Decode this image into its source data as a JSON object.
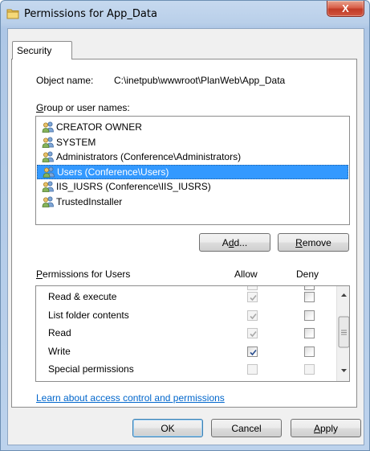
{
  "window": {
    "title": "Permissions for App_Data",
    "close_label": "X"
  },
  "tabs": [
    {
      "label": "Security"
    }
  ],
  "object": {
    "label": "Object name:",
    "value": "C:\\inetpub\\wwwroot\\PlanWeb\\App_Data"
  },
  "groups": {
    "label": "Group or user names:",
    "items": [
      {
        "label": "CREATOR OWNER",
        "selected": false
      },
      {
        "label": "SYSTEM",
        "selected": false
      },
      {
        "label": "Administrators (Conference\\Administrators)",
        "selected": false
      },
      {
        "label": "Users (Conference\\Users)",
        "selected": true
      },
      {
        "label": "IIS_IUSRS (Conference\\IIS_IUSRS)",
        "selected": false
      },
      {
        "label": "TrustedInstaller",
        "selected": false
      }
    ],
    "add_label": "Add...",
    "remove_label": "Remove"
  },
  "permissions": {
    "label": "Permissions for Users",
    "allow_label": "Allow",
    "deny_label": "Deny",
    "rows": [
      {
        "label": "Read & execute",
        "allow": true,
        "allow_disabled": true,
        "deny": false
      },
      {
        "label": "List folder contents",
        "allow": true,
        "allow_disabled": true,
        "deny": false
      },
      {
        "label": "Read",
        "allow": true,
        "allow_disabled": true,
        "deny": false
      },
      {
        "label": "Write",
        "allow": true,
        "allow_disabled": false,
        "deny": false
      },
      {
        "label": "Special permissions",
        "allow": false,
        "allow_disabled": true,
        "deny": false
      }
    ]
  },
  "footer": {
    "link": "Learn about access control and permissions",
    "ok_label": "OK",
    "cancel_label": "Cancel",
    "apply_label": "Apply"
  },
  "icons": {
    "title_icon": "folder-icon",
    "user_icon": "user-group-icon",
    "check_color": "#2a4f8f",
    "selection_color": "#3399ff",
    "link_color": "#0066cc"
  }
}
